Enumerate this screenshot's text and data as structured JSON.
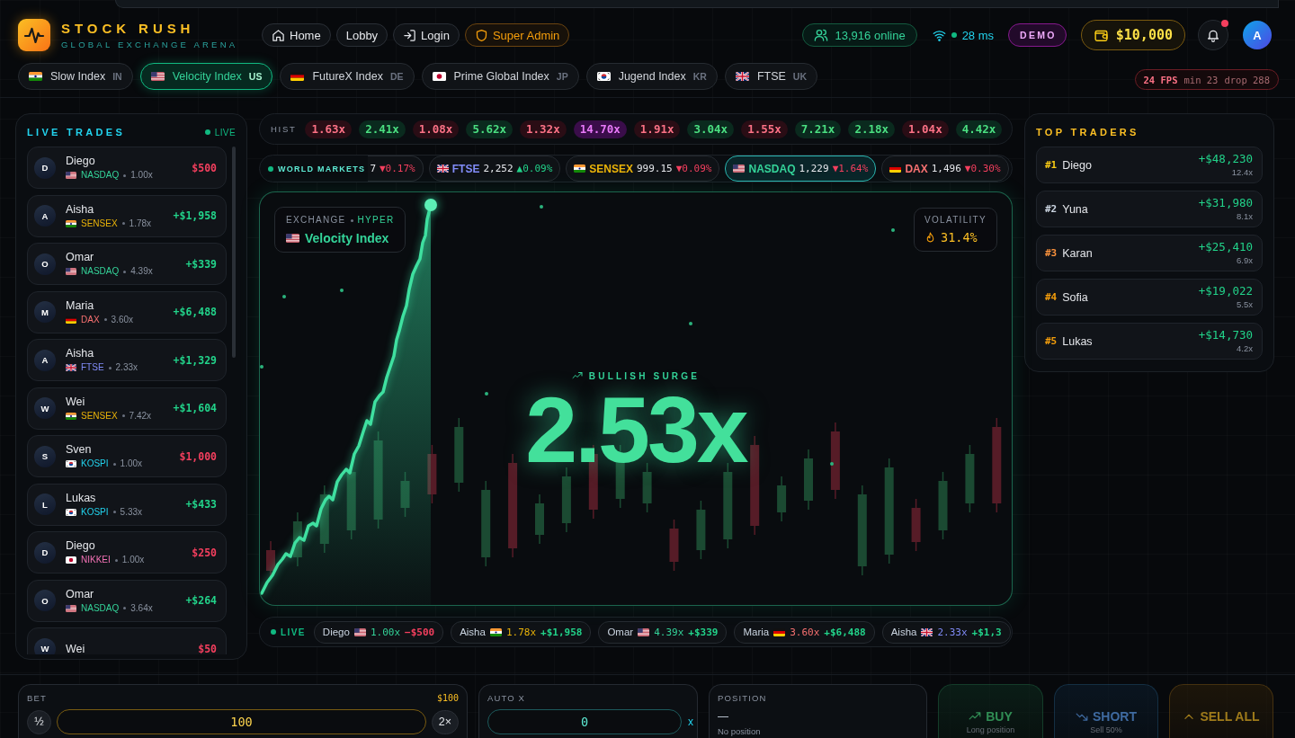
{
  "header": {
    "brand": {
      "title": "STOCK RUSH",
      "subtitle": "GLOBAL EXCHANGE ARENA"
    },
    "nav": [
      {
        "label": "Home",
        "kind": "home"
      },
      {
        "label": "Lobby",
        "kind": "plain"
      },
      {
        "label": "Login",
        "kind": "login"
      },
      {
        "label": "Super Admin",
        "kind": "admin"
      }
    ],
    "online": "13,916 online",
    "latency": "28 ms",
    "mode": "DEMO",
    "balance": "$10,000",
    "notifications": {
      "unread": true
    },
    "avatar": "A"
  },
  "index_tabs": [
    {
      "kind": "in",
      "label": "Slow Index",
      "code": "IN",
      "selected": false
    },
    {
      "kind": "us",
      "label": "Velocity Index",
      "code": "US",
      "selected": true
    },
    {
      "kind": "de",
      "label": "FutureX Index",
      "code": "DE",
      "selected": false
    },
    {
      "kind": "jp",
      "label": "Prime Global Index",
      "code": "JP",
      "selected": false
    },
    {
      "kind": "kr",
      "label": "Jugend Index",
      "code": "KR",
      "selected": false
    },
    {
      "kind": "uk",
      "label": "FTSE",
      "code": "UK",
      "selected": false
    }
  ],
  "fps_meter": {
    "fps": "24 FPS",
    "min": "min 23",
    "drop": "drop 288"
  },
  "live_trades": {
    "title": "LIVE TRADES",
    "badge": "LIVE",
    "trades": [
      {
        "initial": "D",
        "name": "Diego",
        "kind": "us",
        "index": "NASDAQ",
        "color": "#34d399",
        "multiplier": "1.00x",
        "amount": "$500",
        "won": false
      },
      {
        "initial": "A",
        "name": "Aisha",
        "kind": "in",
        "index": "SENSEX",
        "color": "#eab308",
        "multiplier": "1.78x",
        "amount": "+$1,958",
        "won": true
      },
      {
        "initial": "O",
        "name": "Omar",
        "kind": "us",
        "index": "NASDAQ",
        "color": "#34d399",
        "multiplier": "4.39x",
        "amount": "+$339",
        "won": true
      },
      {
        "initial": "M",
        "name": "Maria",
        "kind": "de",
        "index": "DAX",
        "color": "#f87171",
        "multiplier": "3.60x",
        "amount": "+$6,488",
        "won": true
      },
      {
        "initial": "A",
        "name": "Aisha",
        "kind": "uk",
        "index": "FTSE",
        "color": "#818cf8",
        "multiplier": "2.33x",
        "amount": "+$1,329",
        "won": true
      },
      {
        "initial": "W",
        "name": "Wei",
        "kind": "in",
        "index": "SENSEX",
        "color": "#eab308",
        "multiplier": "7.42x",
        "amount": "+$1,604",
        "won": true
      },
      {
        "initial": "S",
        "name": "Sven",
        "kind": "kr",
        "index": "KOSPI",
        "color": "#22d3ee",
        "multiplier": "1.00x",
        "amount": "$1,000",
        "won": false
      },
      {
        "initial": "L",
        "name": "Lukas",
        "kind": "kr",
        "index": "KOSPI",
        "color": "#22d3ee",
        "multiplier": "5.33x",
        "amount": "+$433",
        "won": true
      },
      {
        "initial": "D",
        "name": "Diego",
        "kind": "jp",
        "index": "NIKKEI",
        "color": "#f472b6",
        "multiplier": "1.00x",
        "amount": "$250",
        "won": false
      },
      {
        "initial": "O",
        "name": "Omar",
        "kind": "us",
        "index": "NASDAQ",
        "color": "#34d399",
        "multiplier": "3.64x",
        "amount": "+$264",
        "won": true
      },
      {
        "initial": "W",
        "name": "Wei",
        "kind": "cut",
        "amount": "$50",
        "won": false
      }
    ]
  },
  "history": {
    "label": "HIST",
    "multipliers": [
      {
        "value": "1.63x",
        "kind": "low"
      },
      {
        "value": "2.41x",
        "kind": "mid"
      },
      {
        "value": "1.08x",
        "kind": "low"
      },
      {
        "value": "5.62x",
        "kind": "mid"
      },
      {
        "value": "1.32x",
        "kind": "low"
      },
      {
        "value": "14.70x",
        "kind": "high"
      },
      {
        "value": "1.91x",
        "kind": "low"
      },
      {
        "value": "3.04x",
        "kind": "mid"
      },
      {
        "value": "1.55x",
        "kind": "low"
      },
      {
        "value": "7.21x",
        "kind": "mid"
      },
      {
        "value": "2.18x",
        "kind": "mid"
      },
      {
        "value": "1.04x",
        "kind": "low"
      },
      {
        "value": "4.42x",
        "kind": "mid"
      }
    ]
  },
  "world_markets": {
    "label": "WORLD MARKETS",
    "tickers": [
      {
        "kind": "cut",
        "value": "7",
        "change": "▼0.17%",
        "rising": false,
        "selected": false
      },
      {
        "kind": "uk",
        "name": "FTSE",
        "color": "#818cf8",
        "value": "2,252",
        "change": "▲0.09%",
        "rising": true,
        "selected": false
      },
      {
        "kind": "in",
        "name": "SENSEX",
        "color": "#eab308",
        "value": "999.15",
        "change": "▼0.09%",
        "rising": false,
        "selected": false
      },
      {
        "kind": "us",
        "name": "NASDAQ",
        "color": "#34d399",
        "value": "1,229",
        "change": "▼1.64%",
        "rising": false,
        "selected": true
      },
      {
        "kind": "de",
        "name": "DAX",
        "color": "#f87171",
        "value": "1,496",
        "change": "▼0.30%",
        "rising": false,
        "selected": false
      }
    ]
  },
  "chart": {
    "exchange": "EXCHANGE",
    "mode": "HYPER",
    "kind": "us",
    "market": "Velocity Index",
    "volatility_label": "VOLATILITY",
    "volatility": "31.4%",
    "signal": "BULLISH SURGE",
    "multiplier": "2.53x"
  },
  "live_feed": {
    "label": "LIVE",
    "items": [
      {
        "name": "Diego",
        "kind": "us",
        "multiplier": "1.00x",
        "color": "#34d399",
        "amount": "−$500",
        "won": false
      },
      {
        "name": "Aisha",
        "kind": "in",
        "multiplier": "1.78x",
        "color": "#eab308",
        "amount": "+$1,958",
        "won": true
      },
      {
        "name": "Omar",
        "kind": "us",
        "multiplier": "4.39x",
        "color": "#34d399",
        "amount": "+$339",
        "won": true
      },
      {
        "name": "Maria",
        "kind": "de",
        "multiplier": "3.60x",
        "color": "#f87171",
        "amount": "+$6,488",
        "won": true
      },
      {
        "name": "Aisha",
        "kind": "uk",
        "multiplier": "2.33x",
        "color": "#818cf8",
        "amount": "+$1,3",
        "won": true
      }
    ]
  },
  "top_traders": {
    "title": "TOP TRADERS",
    "traders": [
      {
        "rank": "#1",
        "color": "#facc15",
        "name": "Diego",
        "profit": "+$48,230",
        "multiplier": "12.4x"
      },
      {
        "rank": "#2",
        "color": "#cbd5e1",
        "name": "Yuna",
        "profit": "+$31,980",
        "multiplier": "8.1x"
      },
      {
        "rank": "#3",
        "color": "#fb923c",
        "name": "Karan",
        "profit": "+$25,410",
        "multiplier": "6.9x"
      },
      {
        "rank": "#4",
        "color": "#f59e0b",
        "name": "Sofia",
        "profit": "+$19,022",
        "multiplier": "5.5x"
      },
      {
        "rank": "#5",
        "color": "#f59e0b",
        "name": "Lukas",
        "profit": "+$14,730",
        "multiplier": "4.2x"
      }
    ]
  },
  "controls": {
    "bet": {
      "label": "BET",
      "max": "$100",
      "half": "½",
      "value": "100",
      "double": "2×"
    },
    "auto": {
      "label": "AUTO X",
      "value": "0",
      "suffix": "x"
    },
    "position": {
      "label": "POSITION",
      "value": "—",
      "note": "No position"
    },
    "actions": [
      {
        "kind": "buy",
        "label": "BUY",
        "note": "Long position",
        "disabled": true
      },
      {
        "kind": "short",
        "label": "SHORT",
        "note": "Sell 50%",
        "disabled": true
      },
      {
        "kind": "sell_all",
        "label": "SELL ALL",
        "disabled": true
      }
    ]
  }
}
